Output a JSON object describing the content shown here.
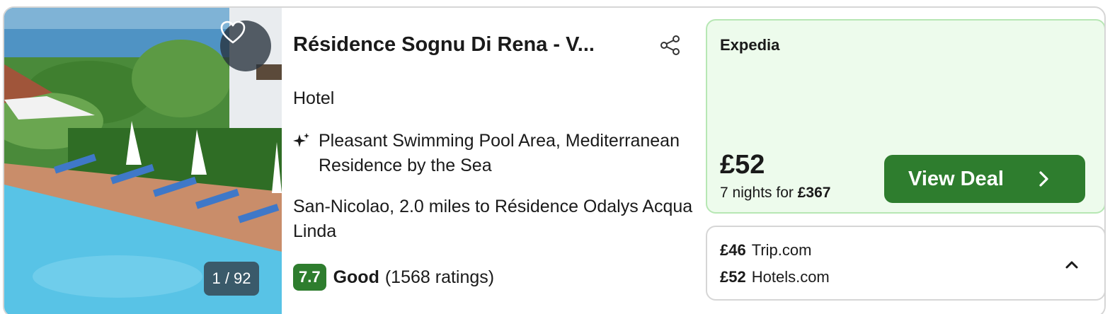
{
  "hotel": {
    "name": "Résidence Sognu Di Rena - V...",
    "type": "Hotel",
    "feature": "Pleasant Swimming Pool Area, Mediterranean Residence by the Sea",
    "location": "San-Nicolao, 2.0 miles to Résidence Odalys Acqua Linda",
    "rating_score": "7.7",
    "rating_word": "Good",
    "rating_count": "(1568 ratings)"
  },
  "photo": {
    "counter": "1 / 92",
    "favorite_icon": "heart-icon"
  },
  "deal": {
    "provider": "Expedia",
    "price": "£52",
    "nights_text": "7 nights for",
    "total": "£367",
    "button_label": "View Deal"
  },
  "other_deals": [
    {
      "price": "£46",
      "provider": "Trip.com"
    },
    {
      "price": "£52",
      "provider": "Hotels.com"
    }
  ],
  "colors": {
    "accent_green": "#2e7d2e",
    "deal_background": "#edfbec",
    "deal_border": "#b7e7b4"
  }
}
